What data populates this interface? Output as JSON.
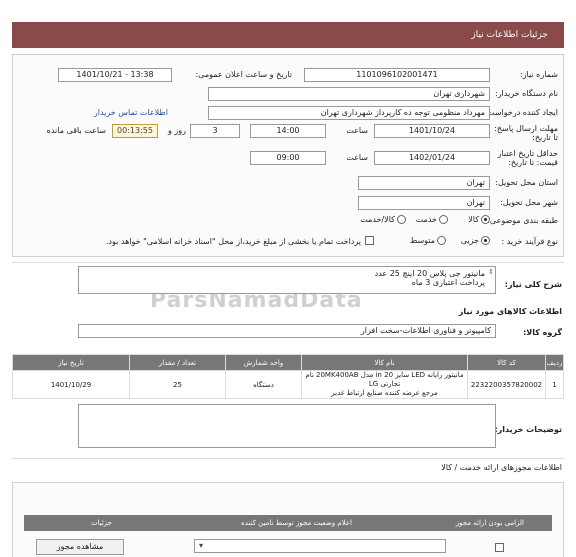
{
  "header": {
    "title": "جزئیات اطلاعات نیاز"
  },
  "form": {
    "need_number_label": "شماره نیاز:",
    "need_number": "1101096102001471",
    "announce_label": "تاریخ و ساعت اعلان عمومی:",
    "announce_value": "1401/10/21 - 13:38",
    "buyer_org_label": "نام دستگاه خریدار:",
    "buyer_org": "شهرداری تهران",
    "creator_label": "ایجاد کننده درخواست:",
    "creator": "مهرداد منظومی توجه ده کارپرداز شهرداری تهران",
    "contact_link": "اطلاعات تماس خریدار",
    "deadline_label": "مهلت ارسال پاسخ: تا تاریخ:",
    "deadline_date": "1401/10/24",
    "time_label": "ساعت",
    "deadline_time": "14:00",
    "days_value": "3",
    "days_label": "روز و",
    "timer": "00:13:55",
    "remaining_label": "ساعت باقی مانده",
    "validity_label": "حداقل تاریخ اعتبار قیمت: تا تاریخ:",
    "validity_date": "1402/01/24",
    "validity_time": "09:00",
    "province_label": "استان محل تحویل:",
    "province": "تهران",
    "city_label": "شهر محل تحویل:",
    "city": "تهران",
    "category_label": "طبقه بندی موضوعی:",
    "cat_goods": "کالا",
    "cat_service": "خدمت",
    "cat_goods_service": "کالا/خدمت",
    "process_label": "نوع فرآیند خرید :",
    "proc_partial": "جزیی",
    "proc_medium": "متوسط",
    "payment_note": "پرداخت تمام یا بخشی از مبلغ خرید،از محل \"اسناد خزانه اسلامی\" خواهد بود."
  },
  "summary": {
    "label": "شرح کلی نیاز:",
    "line1": "مانیتور جی پلاس 20 اینچ 25 عدد",
    "line2": "پرداخت اعتباری 3 ماه"
  },
  "goods": {
    "section_title": "اطلاعات کالاهای مورد نیاز",
    "group_label": "گروه کالا:",
    "group_value": "کامپیوتر و فناوری اطلاعات-سخت افزار",
    "columns": [
      "ردیف",
      "کد کالا",
      "نام کالا",
      "واحد شمارش",
      "تعداد / مقدار",
      "تاریخ نیاز"
    ],
    "rows": [
      {
        "idx": "1",
        "code": "2232200357820002",
        "name_line1": "مانیتور رایانه LED سایز 20 in مدل 20MK400AB نام تجارتی LG",
        "name_line2": "مرجع عرضه کننده صنایع ارتباط غدیر",
        "unit": "دستگاه",
        "qty": "25",
        "date": "1401/10/29"
      }
    ]
  },
  "notes": {
    "label": "توضیحات خریدار:"
  },
  "licenses": {
    "title": "اطلاعات مجوزهای ارائه خدمت / کالا",
    "columns": [
      "الزامی بودن ارائه مجوز",
      "اعلام وضعیت مجوز توسط نامین کننده",
      "جزئیات"
    ],
    "view_button": "مشاهده مجوز"
  },
  "watermark": {
    "text": "ParsNamadData"
  },
  "colors": {
    "header_bg": "#8b4a4a",
    "link": "#1f4fa8",
    "table_header": "#777777"
  }
}
